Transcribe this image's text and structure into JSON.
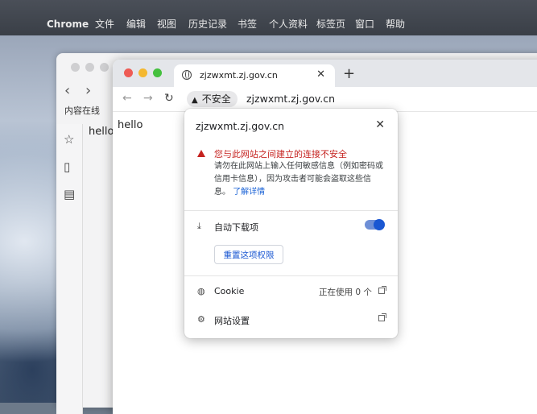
{
  "menubar": {
    "app_name": "Chrome",
    "items": [
      "文件",
      "编辑",
      "视图",
      "历史记录",
      "书签",
      "个人资料",
      "标签页",
      "窗口",
      "帮助"
    ]
  },
  "back_window": {
    "sidebar_label": "内容在线",
    "hello_text": "hello"
  },
  "tab": {
    "title": "zjzwxmt.zj.gov.cn",
    "close_label": "✕",
    "new_tab_label": "+"
  },
  "toolbar": {
    "security_chip_label": "不安全",
    "url": "zjzwxmt.zj.gov.cn"
  },
  "page": {
    "hello_text": "hello"
  },
  "popup": {
    "host": "zjzwxmt.zj.gov.cn",
    "close_label": "✕",
    "warning_title": "您与此网站之间建立的连接不安全",
    "warning_body": "请勿在此网站上输入任何敏感信息（例如密码或信用卡信息），因为攻击者可能会盗取这些信息。",
    "learn_more": "了解详情",
    "auto_download_label": "自动下载项",
    "auto_download_enabled": true,
    "reset_button_label": "重置这项权限",
    "cookie_label": "Cookie",
    "cookie_status": "正在使用 0 个",
    "site_settings_label": "网站设置"
  },
  "colors": {
    "warning_red": "#c5221f",
    "accent_blue": "#1a57d2"
  },
  "icons": [
    "apple-icon",
    "globe-icon",
    "back-arrow-icon",
    "forward-arrow-icon",
    "reload-icon",
    "warning-icon",
    "close-icon",
    "download-icon",
    "cookie-icon",
    "gear-icon",
    "external-link-icon",
    "star-icon",
    "book-icon",
    "document-icon"
  ]
}
